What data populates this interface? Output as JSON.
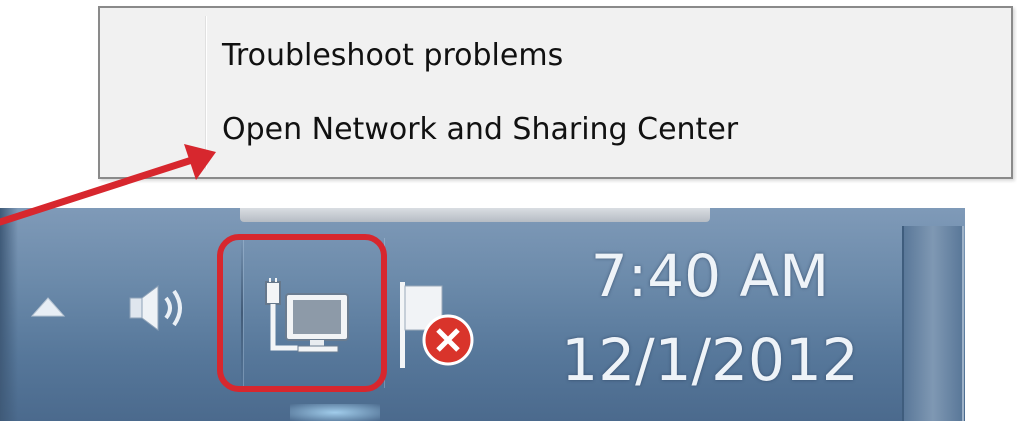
{
  "context_menu": {
    "items": [
      {
        "label": "Troubleshoot problems"
      },
      {
        "label": "Open Network and Sharing Center"
      }
    ]
  },
  "taskbar": {
    "tray": {
      "icons": [
        "show-hidden-icons-arrow",
        "volume-icon",
        "network-icon",
        "action-center-flag-icon"
      ],
      "clock": {
        "time": "7:40 AM",
        "date": "12/1/2012"
      }
    }
  },
  "annotation": {
    "highlight_color": "#d7272e",
    "arrow_color": "#d7272e"
  }
}
